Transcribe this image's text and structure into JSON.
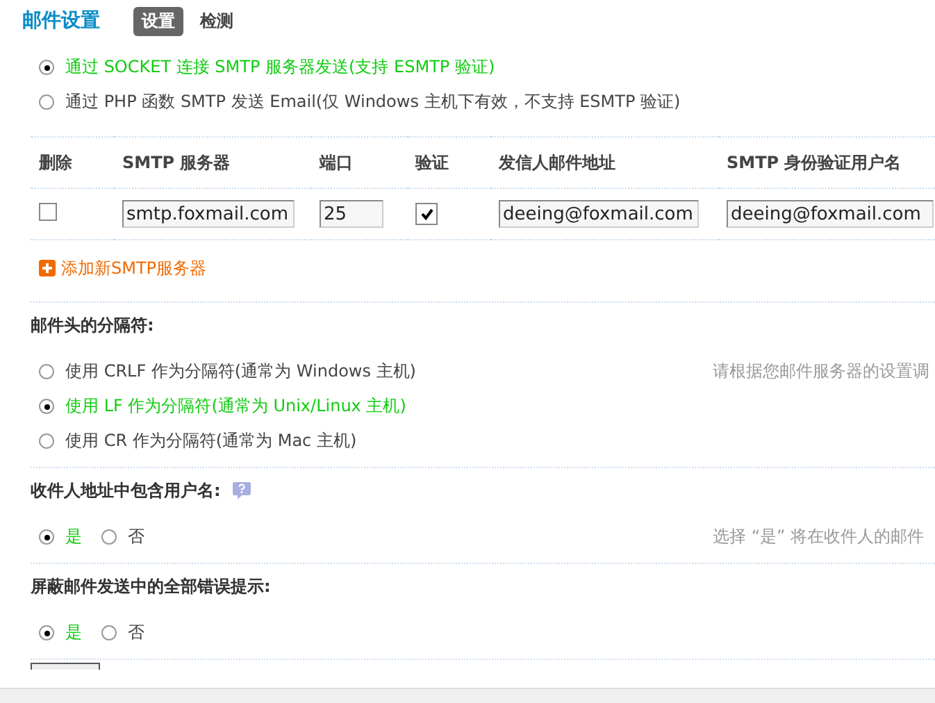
{
  "title": "邮件设置",
  "tabs": [
    {
      "label": "设置",
      "selected": true
    },
    {
      "label": "检测",
      "selected": false
    }
  ],
  "send_methods": [
    {
      "label": "通过  SOCKET 连接  SMTP 服务器发送(支持  ESMTP 验证)",
      "selected": true
    },
    {
      "label": "通过  PHP 函数  SMTP 发送  Email(仅  Windows 主机下有效，不支持  ESMTP 验证)",
      "selected": false
    }
  ],
  "servers": {
    "columns": [
      "删除",
      "SMTP 服务器",
      "端口",
      "验证",
      "发信人邮件地址",
      "SMTP 身份验证用户名"
    ],
    "rows": [
      {
        "delete_checked": false,
        "server": "smtp.foxmail.com",
        "port": "25",
        "auth_checked": true,
        "sender": "deeing@foxmail.com",
        "username": "deeing@foxmail.com"
      }
    ],
    "add_link": "添加新SMTP服务器"
  },
  "sections": [
    {
      "title": "邮件头的分隔符:",
      "has_help": false,
      "hint": "请根据您邮件服务器的设置调",
      "options": [
        {
          "label": "使用  CRLF 作为分隔符(通常为  Windows 主机)",
          "selected": false
        },
        {
          "label": "使用  LF 作为分隔符(通常为  Unix/Linux 主机)",
          "selected": true
        },
        {
          "label": "使用  CR 作为分隔符(通常为  Mac 主机)",
          "selected": false
        }
      ]
    },
    {
      "title": "收件人地址中包含用户名:",
      "has_help": true,
      "hint": "选择 “是” 将在收件人的邮件",
      "options": [
        {
          "label": "是",
          "selected": true
        },
        {
          "label": "否",
          "selected": false
        }
      ]
    },
    {
      "title": "屏蔽邮件发送中的全部错误提示:",
      "has_help": false,
      "options": [
        {
          "label": "是",
          "selected": true
        },
        {
          "label": "否",
          "selected": false
        }
      ]
    }
  ]
}
